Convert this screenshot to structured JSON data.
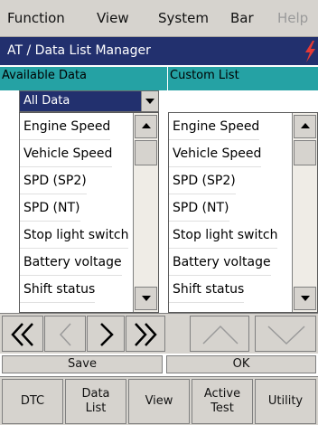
{
  "menubar": {
    "items": [
      {
        "label": "Function",
        "enabled": true
      },
      {
        "label": "View",
        "enabled": true
      },
      {
        "label": "System",
        "enabled": true
      },
      {
        "label": "Bar",
        "enabled": true
      },
      {
        "label": "Help",
        "enabled": false
      }
    ]
  },
  "window": {
    "title": "AT / Data List Manager",
    "corner_icon": "red-lightning-bolt-icon",
    "accent_color": "#e53935"
  },
  "available": {
    "header": "Available Data",
    "dropdown_value": "All Data",
    "items": [
      "Engine Speed",
      "Vehicle Speed",
      "SPD (SP2)",
      "SPD (NT)",
      "Stop light switch",
      "Battery voltage",
      "Shift status"
    ]
  },
  "custom": {
    "header": "Custom List",
    "items": [
      "Engine Speed",
      "Vehicle Speed",
      "SPD (SP2)",
      "SPD (NT)",
      "Stop light switch",
      "Battery voltage",
      "Shift status"
    ]
  },
  "nav": {
    "buttons": [
      {
        "icon": "double-left-chevron-icon",
        "enabled": true
      },
      {
        "icon": "left-chevron-icon",
        "enabled": false
      },
      {
        "icon": "right-chevron-icon",
        "enabled": true
      },
      {
        "icon": "double-right-chevron-icon",
        "enabled": true
      },
      {
        "icon": "up-chevron-icon",
        "enabled": false
      },
      {
        "icon": "down-chevron-icon",
        "enabled": false
      }
    ]
  },
  "actions": {
    "save_label": "Save",
    "ok_label": "OK"
  },
  "tabs": [
    {
      "label": "DTC"
    },
    {
      "label": "Data\nList"
    },
    {
      "label": "View"
    },
    {
      "label": "Active\nTest"
    },
    {
      "label": "Utility"
    }
  ],
  "colors": {
    "chrome": "#d6d3ce",
    "title_bar": "#22306e",
    "header_teal": "#25a2a4",
    "selection": "#22306e"
  }
}
